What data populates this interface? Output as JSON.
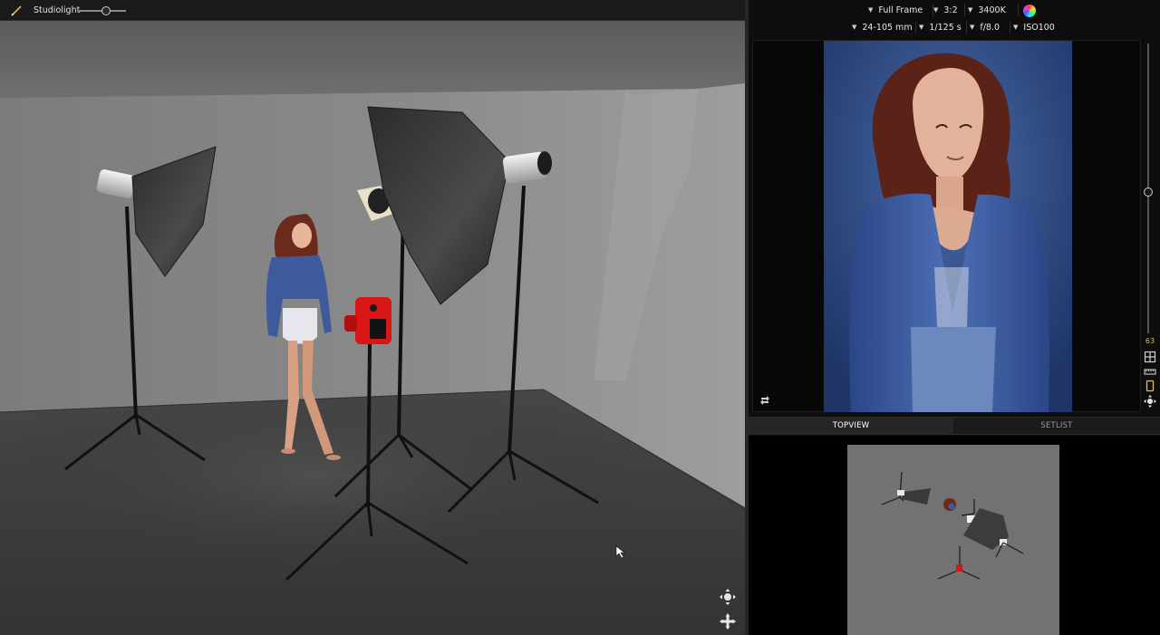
{
  "toolbar": {
    "tool_icon": "pen-icon",
    "light_label": "Studiolight",
    "light_level": 0.55
  },
  "camera": {
    "sensor": "Full Frame",
    "aspect": "3:2",
    "white_balance": "3400K",
    "color_icon": "color-wheel-icon",
    "lens": "24-105 mm",
    "shutter": "1/125 s",
    "aperture": "f/8.0",
    "iso": "ISO100"
  },
  "preview": {
    "zoom_value": "63",
    "zoom_level": 0.5,
    "rotate_icon": "rotate-icon",
    "side_icons": [
      "grid-icon",
      "ruler-icon",
      "portrait-frame-icon",
      "move-icon"
    ]
  },
  "tabs": [
    {
      "label": "TOPVIEW",
      "active": true
    },
    {
      "label": "SETLIST",
      "active": false
    }
  ],
  "viewport": {
    "nav_icons": [
      "orbit-icon",
      "pan-icon"
    ],
    "colors": {
      "backdrop": "#7a7a7a",
      "floor": "#3b3b3b",
      "camera_red": "#d81616",
      "jacket_blue": "#3d5b9c"
    }
  }
}
